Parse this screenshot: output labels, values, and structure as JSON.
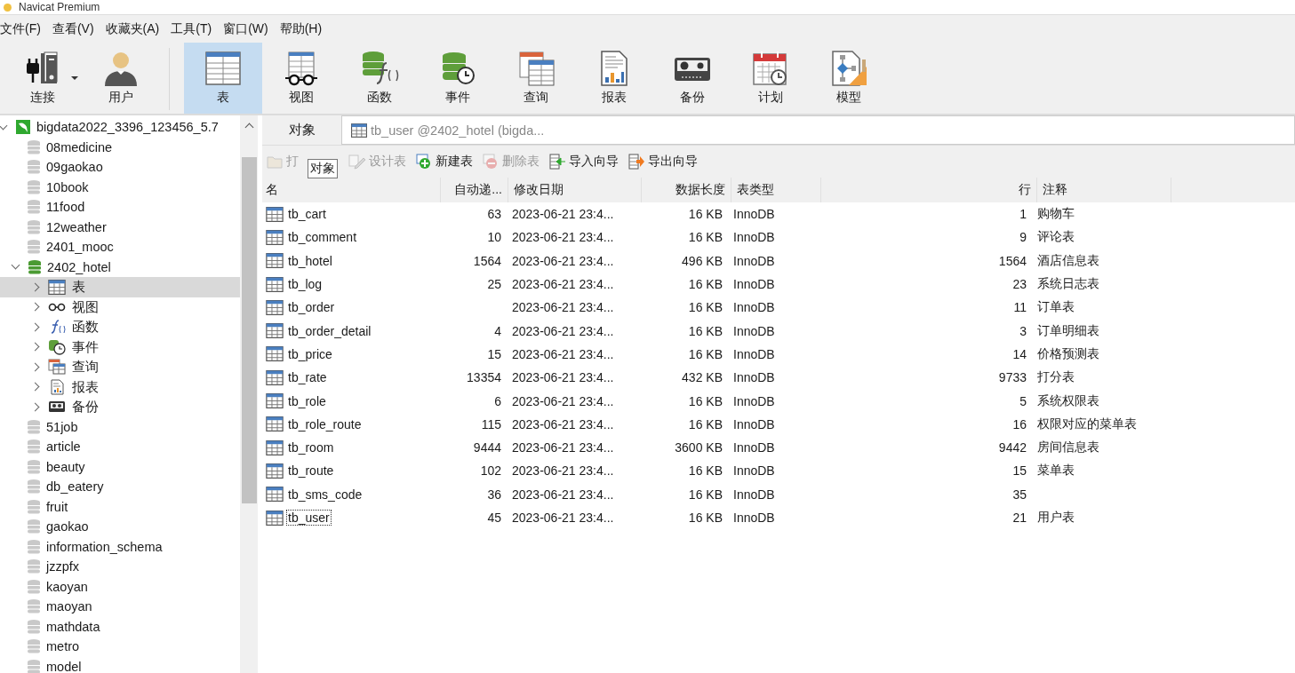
{
  "window": {
    "title": "Navicat Premium"
  },
  "menu": [
    "文件(F)",
    "查看(V)",
    "收藏夹(A)",
    "工具(T)",
    "窗口(W)",
    "帮助(H)"
  ],
  "toolbar": [
    {
      "label": "连接",
      "selected": false,
      "dropdown": true
    },
    {
      "label": "用户",
      "selected": false,
      "dropdown": false
    },
    {
      "label": "表",
      "selected": true,
      "dropdown": false
    },
    {
      "label": "视图",
      "selected": false,
      "dropdown": false
    },
    {
      "label": "函数",
      "selected": false,
      "dropdown": false
    },
    {
      "label": "事件",
      "selected": false,
      "dropdown": false
    },
    {
      "label": "查询",
      "selected": false,
      "dropdown": false
    },
    {
      "label": "报表",
      "selected": false,
      "dropdown": false
    },
    {
      "label": "备份",
      "selected": false,
      "dropdown": false
    },
    {
      "label": "计划",
      "selected": false,
      "dropdown": false
    },
    {
      "label": "模型",
      "selected": false,
      "dropdown": false
    }
  ],
  "sidebar": {
    "connection": {
      "label": "bigdata2022_3396_123456_5.7",
      "expanded": true
    },
    "databases": [
      {
        "label": "08medicine",
        "expanded": false
      },
      {
        "label": "09gaokao",
        "expanded": false
      },
      {
        "label": "10book",
        "expanded": false
      },
      {
        "label": "11food",
        "expanded": false
      },
      {
        "label": "12weather",
        "expanded": false
      },
      {
        "label": "2401_mooc",
        "expanded": false
      },
      {
        "label": "2402_hotel",
        "expanded": true,
        "children": [
          {
            "label": "表",
            "selected": true
          },
          {
            "label": "视图",
            "selected": false
          },
          {
            "label": "函数",
            "selected": false
          },
          {
            "label": "事件",
            "selected": false
          },
          {
            "label": "查询",
            "selected": false
          },
          {
            "label": "报表",
            "selected": false
          },
          {
            "label": "备份",
            "selected": false
          }
        ]
      },
      {
        "label": "51job",
        "expanded": false
      },
      {
        "label": "article",
        "expanded": false
      },
      {
        "label": "beauty",
        "expanded": false
      },
      {
        "label": "db_eatery",
        "expanded": false
      },
      {
        "label": "fruit",
        "expanded": false
      },
      {
        "label": "gaokao",
        "expanded": false
      },
      {
        "label": "information_schema",
        "expanded": false
      },
      {
        "label": "jzzpfx",
        "expanded": false
      },
      {
        "label": "kaoyan",
        "expanded": false
      },
      {
        "label": "maoyan",
        "expanded": false
      },
      {
        "label": "mathdata",
        "expanded": false
      },
      {
        "label": "metro",
        "expanded": false
      },
      {
        "label": "model",
        "expanded": false
      }
    ]
  },
  "tabs": [
    {
      "label": "对象",
      "selected": true
    },
    {
      "label": "tb_user @2402_hotel (bigda...",
      "selected": false
    }
  ],
  "actions": [
    {
      "label": "打",
      "disabled": true
    },
    {
      "label": "设计表",
      "disabled": true
    },
    {
      "label": "新建表",
      "disabled": false
    },
    {
      "label": "删除表",
      "disabled": true
    },
    {
      "label": "导入向导",
      "disabled": false
    },
    {
      "label": "导出向导",
      "disabled": false
    }
  ],
  "tooltip": "对象",
  "table": {
    "columns": [
      "名",
      "自动递...",
      "修改日期",
      "数据长度",
      "表类型",
      "行",
      "注释"
    ],
    "rows": [
      {
        "name": "tb_cart",
        "auto_increment": "63",
        "modified": "2023-06-21 23:4...",
        "data_length": "16 KB",
        "engine": "InnoDB",
        "rows": "1",
        "comment": "购物车",
        "selected": false
      },
      {
        "name": "tb_comment",
        "auto_increment": "10",
        "modified": "2023-06-21 23:4...",
        "data_length": "16 KB",
        "engine": "InnoDB",
        "rows": "9",
        "comment": "评论表",
        "selected": false
      },
      {
        "name": "tb_hotel",
        "auto_increment": "1564",
        "modified": "2023-06-21 23:4...",
        "data_length": "496 KB",
        "engine": "InnoDB",
        "rows": "1564",
        "comment": "酒店信息表",
        "selected": false
      },
      {
        "name": "tb_log",
        "auto_increment": "25",
        "modified": "2023-06-21 23:4...",
        "data_length": "16 KB",
        "engine": "InnoDB",
        "rows": "23",
        "comment": "系统日志表",
        "selected": false
      },
      {
        "name": "tb_order",
        "modified": "2023-06-21 23:4...",
        "data_length": "16 KB",
        "engine": "InnoDB",
        "rows": "11",
        "comment": "订单表",
        "selected": false
      },
      {
        "name": "tb_order_detail",
        "auto_increment": "4",
        "modified": "2023-06-21 23:4...",
        "data_length": "16 KB",
        "engine": "InnoDB",
        "rows": "3",
        "comment": "订单明细表",
        "selected": false
      },
      {
        "name": "tb_price",
        "auto_increment": "15",
        "modified": "2023-06-21 23:4...",
        "data_length": "16 KB",
        "engine": "InnoDB",
        "rows": "14",
        "comment": "价格预测表",
        "selected": false
      },
      {
        "name": "tb_rate",
        "auto_increment": "13354",
        "modified": "2023-06-21 23:4...",
        "data_length": "432 KB",
        "engine": "InnoDB",
        "rows": "9733",
        "comment": "打分表",
        "selected": false
      },
      {
        "name": "tb_role",
        "auto_increment": "6",
        "modified": "2023-06-21 23:4...",
        "data_length": "16 KB",
        "engine": "InnoDB",
        "rows": "5",
        "comment": "系统权限表",
        "selected": false
      },
      {
        "name": "tb_role_route",
        "auto_increment": "115",
        "modified": "2023-06-21 23:4...",
        "data_length": "16 KB",
        "engine": "InnoDB",
        "rows": "16",
        "comment": "权限对应的菜单表",
        "selected": false
      },
      {
        "name": "tb_room",
        "auto_increment": "9444",
        "modified": "2023-06-21 23:4...",
        "data_length": "3600 KB",
        "engine": "InnoDB",
        "rows": "9442",
        "comment": "房间信息表",
        "selected": false
      },
      {
        "name": "tb_route",
        "auto_increment": "102",
        "modified": "2023-06-21 23:4...",
        "data_length": "16 KB",
        "engine": "InnoDB",
        "rows": "15",
        "comment": "菜单表",
        "selected": false
      },
      {
        "name": "tb_sms_code",
        "auto_increment": "36",
        "modified": "2023-06-21 23:4...",
        "data_length": "16 KB",
        "engine": "InnoDB",
        "rows": "35",
        "selected": false
      },
      {
        "name": "tb_user",
        "auto_increment": "45",
        "modified": "2023-06-21 23:4...",
        "data_length": "16 KB",
        "engine": "InnoDB",
        "rows": "21",
        "comment": "用户表",
        "selected": true
      }
    ]
  }
}
